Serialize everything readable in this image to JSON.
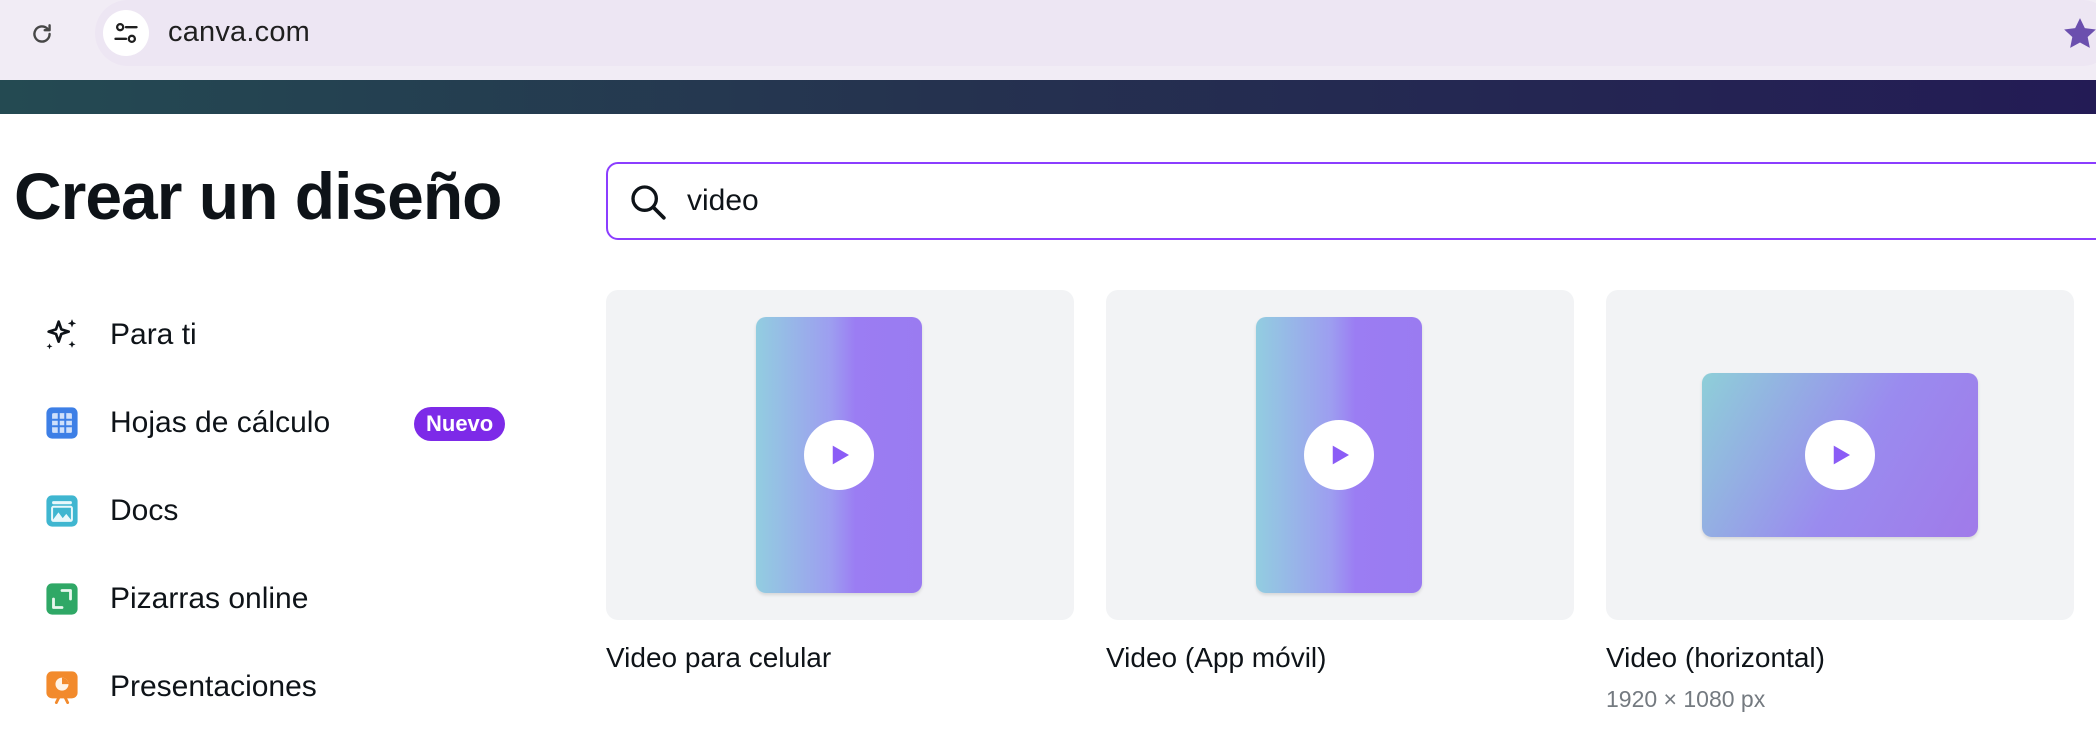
{
  "browser": {
    "url": "canva.com"
  },
  "page": {
    "title": "Crear un diseño"
  },
  "search": {
    "value": "video"
  },
  "sidebar": {
    "items": [
      {
        "label": "Para ti",
        "icon": "sparkles-icon"
      },
      {
        "label": "Hojas de cálculo",
        "icon": "spreadsheet-icon",
        "badge": "Nuevo"
      },
      {
        "label": "Docs",
        "icon": "docs-icon"
      },
      {
        "label": "Pizarras online",
        "icon": "whiteboard-icon"
      },
      {
        "label": "Presentaciones",
        "icon": "presentation-icon"
      }
    ]
  },
  "results": [
    {
      "title": "Video para celular",
      "subtitle": "",
      "orientation": "portrait"
    },
    {
      "title": "Video (App móvil)",
      "subtitle": "",
      "orientation": "portrait"
    },
    {
      "title": "Video (horizontal)",
      "subtitle": "1920 × 1080 px",
      "orientation": "landscape"
    }
  ],
  "colors": {
    "accent": "#8b3dff",
    "badge": "#7d2ae8",
    "banner_start": "#244a52",
    "banner_end": "#231b55"
  }
}
